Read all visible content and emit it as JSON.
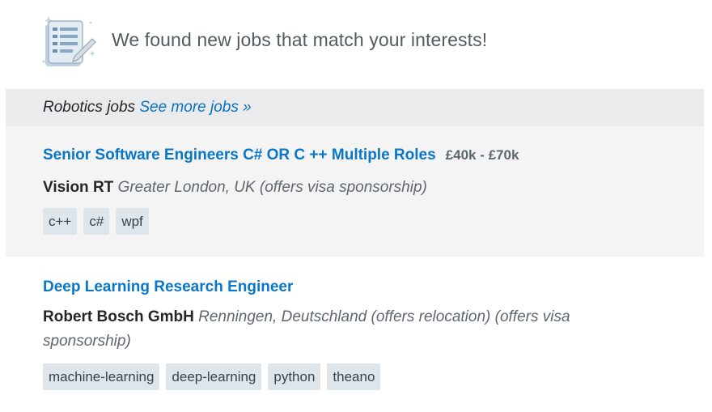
{
  "header": {
    "title": "We found new jobs that match your interests!",
    "icon": "job-listing-icon"
  },
  "section": {
    "label": "Robotics jobs",
    "see_more": "See more jobs »"
  },
  "jobs": [
    {
      "title": "Senior Software Engineers C# OR C ++ Multiple Roles",
      "salary": "£40k - £70k",
      "company": "Vision RT",
      "location": "Greater London, UK (offers visa sponsorship)",
      "tags": [
        "c++",
        "c#",
        "wpf"
      ],
      "highlighted": true
    },
    {
      "title": "Deep Learning Research Engineer",
      "salary": "",
      "company": "Robert Bosch GmbH",
      "location": "Renningen, Deutschland (offers relocation) (offers visa sponsorship)",
      "tags": [
        "machine-learning",
        "deep-learning",
        "python",
        "theano"
      ],
      "highlighted": false
    }
  ],
  "colors": {
    "link": "#0a76c8",
    "section_bg": "#eaebec",
    "highlight_bg": "#f4f4f5",
    "tag_bg": "#dfe6eb"
  }
}
